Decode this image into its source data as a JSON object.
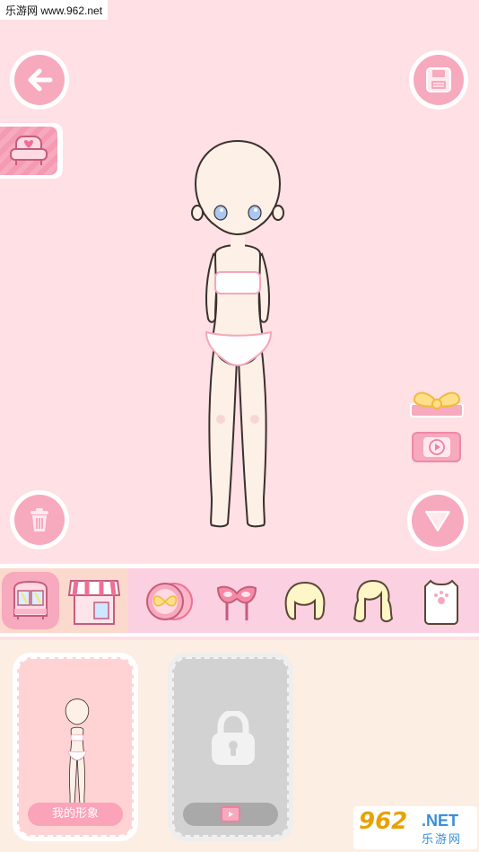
{
  "watermark_top": "乐游网 www.962.net",
  "colors": {
    "background": "#ffe0e4",
    "accent_pink": "#f7a9be",
    "panel": "#fdeee4",
    "locked_gray": "#d2d2d2"
  },
  "toolbar": {
    "back_icon": "arrow-left-icon",
    "save_icon": "floppy-disk-icon",
    "sofa_icon": "heart-sofa-icon",
    "trash_icon": "trash-icon",
    "collapse_icon": "triangle-down-icon",
    "bow_icon": "golden-bow-icon",
    "video_icon": "play-video-icon"
  },
  "category_tabs": {
    "left": [
      {
        "name": "wardrobe",
        "icon": "wardrobe-icon",
        "selected": true
      },
      {
        "name": "shop",
        "icon": "shop-awning-icon",
        "selected": false
      }
    ],
    "items": [
      {
        "name": "background",
        "icon": "bow-plate-icon"
      },
      {
        "name": "mask",
        "icon": "masquerade-mask-icon"
      },
      {
        "name": "short-hair",
        "icon": "short-hair-icon"
      },
      {
        "name": "long-hair",
        "icon": "curly-hair-icon"
      },
      {
        "name": "top",
        "icon": "paw-shirt-icon"
      }
    ]
  },
  "slots": [
    {
      "label": "我的形象",
      "locked": false
    },
    {
      "label": "",
      "locked": true,
      "unlock_icon": "play-video-icon"
    }
  ],
  "watermark_br": {
    "logo": "962",
    "suffix": ".NET",
    "site": "乐游网"
  }
}
